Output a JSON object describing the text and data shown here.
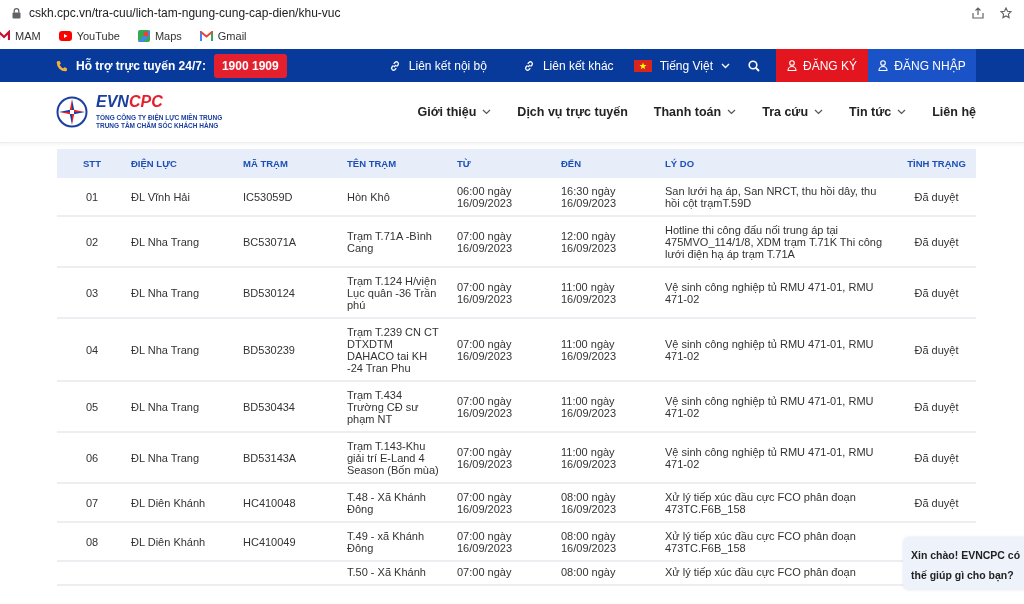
{
  "browser": {
    "url": "cskh.cpc.vn/tra-cuu/lich-tam-ngung-cung-cap-dien/khu-vuc",
    "bookmarks": [
      {
        "label": "MAM",
        "kind": "mam"
      },
      {
        "label": "YouTube",
        "kind": "youtube"
      },
      {
        "label": "Maps",
        "kind": "maps"
      },
      {
        "label": "Gmail",
        "kind": "gmail"
      }
    ]
  },
  "topbar": {
    "support_label": "Hỗ trợ trực tuyến 24/7:",
    "hotline": "1900 1909",
    "links": [
      "Liên kết nội bộ",
      "Liên kết khác"
    ],
    "language": "Tiếng Việt",
    "register": "ĐĂNG KÝ",
    "login": "ĐĂNG NHẬP"
  },
  "header": {
    "logo": {
      "brand_a": "EVN",
      "brand_b": "CPC",
      "line1": "TỔNG CÔNG TY ĐIỆN LỰC MIỀN TRUNG",
      "line2": "TRUNG TÂM CHĂM SÓC KHÁCH HÀNG"
    },
    "menu": [
      {
        "label": "Giới thiệu",
        "has_dropdown": true
      },
      {
        "label": "Dịch vụ trực tuyến",
        "has_dropdown": false
      },
      {
        "label": "Thanh toán",
        "has_dropdown": true
      },
      {
        "label": "Tra cứu",
        "has_dropdown": true
      },
      {
        "label": "Tin tức",
        "has_dropdown": true
      },
      {
        "label": "Liên hệ",
        "has_dropdown": false
      }
    ]
  },
  "table": {
    "columns": [
      "STT",
      "ĐIỆN LỰC",
      "MÃ TRẠM",
      "TÊN TRẠM",
      "TỪ",
      "ĐẾN",
      "LÝ DO",
      "TÌNH TRẠNG"
    ],
    "rows": [
      {
        "stt": "01",
        "dien_luc": "ĐL Vĩnh Hải",
        "ma_tram": "IC53059D",
        "ten_tram": "Hòn Khô",
        "tu": "06:00 ngày 16/09/2023",
        "den": "16:30 ngày 16/09/2023",
        "ly_do": "San lưới hạ áp, San NRCT, thu hồi dây, thu hồi cột trạmT.59D",
        "tinh_trang": "Đã duyệt"
      },
      {
        "stt": "02",
        "dien_luc": "ĐL Nha Trang",
        "ma_tram": "BC53071A",
        "ten_tram": "Trạm T.71A -Bình Cang",
        "tu": "07:00 ngày 16/09/2023",
        "den": "12:00 ngày 16/09/2023",
        "ly_do": "Hotline thi công đấu nối trung áp tại 475MVO_114/1/8, XDM trạm T.71K Thi công lưới điện hạ áp trạm T.71A",
        "tinh_trang": "Đã duyệt"
      },
      {
        "stt": "03",
        "dien_luc": "ĐL Nha Trang",
        "ma_tram": "BD530124",
        "ten_tram": "Trạm T.124 H/viện Lục quân -36 Trần phú",
        "tu": "07:00 ngày 16/09/2023",
        "den": "11:00 ngày 16/09/2023",
        "ly_do": "Vệ sinh công nghiệp tủ RMU 471-01, RMU 471-02",
        "tinh_trang": "Đã duyệt"
      },
      {
        "stt": "04",
        "dien_luc": "ĐL Nha Trang",
        "ma_tram": "BD530239",
        "ten_tram": "Trạm T.239 CN CT DTXDTM DAHACO tai KH -24 Tran Phu",
        "tu": "07:00 ngày 16/09/2023",
        "den": "11:00 ngày 16/09/2023",
        "ly_do": "Vệ sinh công nghiệp tủ RMU 471-01, RMU 471-02",
        "tinh_trang": "Đã duyệt"
      },
      {
        "stt": "05",
        "dien_luc": "ĐL Nha Trang",
        "ma_tram": "BD530434",
        "ten_tram": "Trạm T.434 Trường CĐ sư phạm NT",
        "tu": "07:00 ngày 16/09/2023",
        "den": "11:00 ngày 16/09/2023",
        "ly_do": "Vệ sinh công nghiệp tủ RMU 471-01, RMU 471-02",
        "tinh_trang": "Đã duyệt"
      },
      {
        "stt": "06",
        "dien_luc": "ĐL Nha Trang",
        "ma_tram": "BD53143A",
        "ten_tram": "Trạm T.143-Khu giải trí E-Land 4 Season (Bốn mùa)",
        "tu": "07:00 ngày 16/09/2023",
        "den": "11:00 ngày 16/09/2023",
        "ly_do": "Vệ sinh công nghiệp tủ RMU 471-01, RMU 471-02",
        "tinh_trang": "Đã duyệt"
      },
      {
        "stt": "07",
        "dien_luc": "ĐL Diên Khánh",
        "ma_tram": "HC410048",
        "ten_tram": "T.48 - Xã Khánh Đông",
        "tu": "07:00 ngày 16/09/2023",
        "den": "08:00 ngày 16/09/2023",
        "ly_do": "Xử lý tiếp xúc đầu cực FCO phân đoạn 473TC.F6B_158",
        "tinh_trang": "Đã duyệt"
      },
      {
        "stt": "08",
        "dien_luc": "ĐL Diên Khánh",
        "ma_tram": "HC410049",
        "ten_tram": "T.49 - xã Khánh Đông",
        "tu": "07:00 ngày 16/09/2023",
        "den": "08:00 ngày 16/09/2023",
        "ly_do": "Xử lý tiếp xúc đầu cực FCO phân đoạn 473TC.F6B_158"
      },
      {
        "ten_tram": "T.50 - Xã Khánh",
        "tu": "07:00 ngày",
        "den": "08:00 ngày",
        "ly_do": "Xử lý tiếp xúc đầu cực FCO phân đoạn"
      }
    ]
  },
  "chat_bubble": {
    "text": "Xin chào! EVNCPC có thế giúp gì cho bạn?"
  }
}
